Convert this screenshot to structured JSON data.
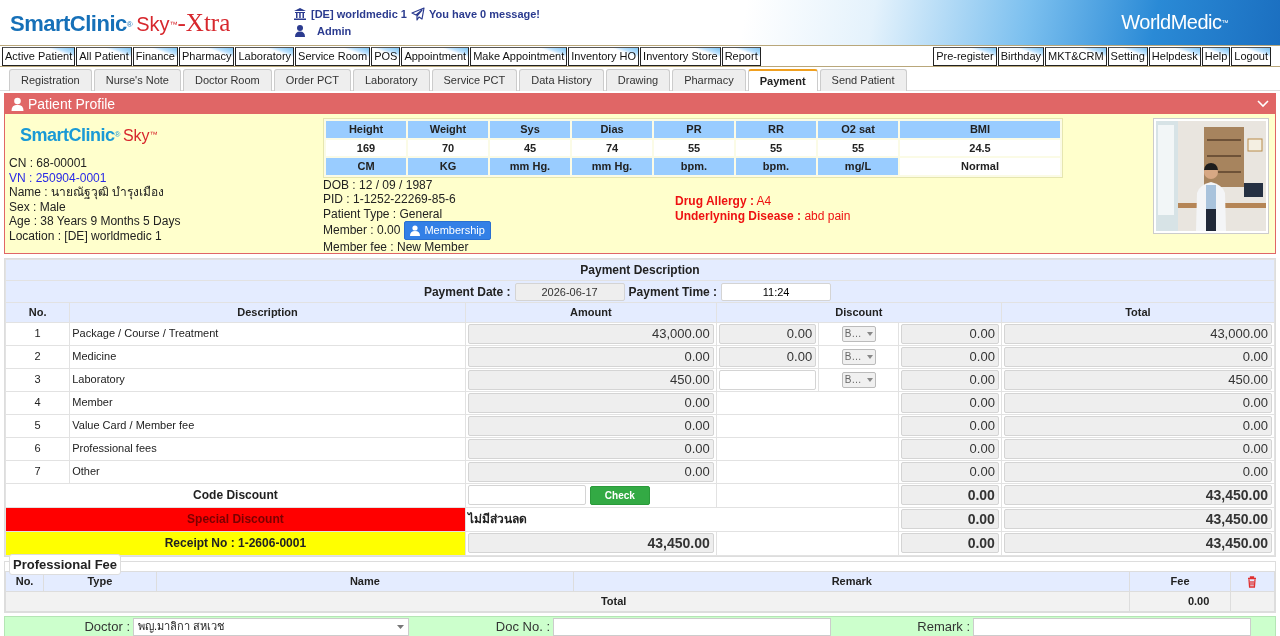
{
  "header": {
    "logo": {
      "name": "SmartClinic$^{®}$",
      "edition": "Sky$^{™}$",
      "suffix": "-Xtra"
    },
    "location": "[DE] worldmedic 1",
    "message": "You have 0 message!",
    "user": "Admin",
    "brand": "WorldMedic$^{™}$"
  },
  "main_menu": {
    "left": [
      "Active Patient",
      "All Patient",
      "Finance",
      "Pharmacy",
      "Laboratory",
      "Service Room",
      "POS",
      "Appointment",
      "Make Appointment",
      "Inventory HO",
      "Inventory Store",
      "Report"
    ],
    "right": [
      "Pre-register",
      "Birthday",
      "MKT&CRM",
      "Setting",
      "Helpdesk",
      "Help",
      "Logout"
    ]
  },
  "tabs": [
    {
      "label": "Registration",
      "selected": false
    },
    {
      "label": "Nurse's Note",
      "selected": false
    },
    {
      "label": "Doctor Room",
      "selected": false
    },
    {
      "label": "Order PCT",
      "selected": false
    },
    {
      "label": "Laboratory",
      "selected": false
    },
    {
      "label": "Service PCT",
      "selected": false
    },
    {
      "label": "Data History",
      "selected": false
    },
    {
      "label": "Drawing",
      "selected": false
    },
    {
      "label": "Pharmacy",
      "selected": false
    },
    {
      "label": "Payment",
      "selected": true
    },
    {
      "label": "Send Patient",
      "selected": false
    }
  ],
  "patient_profile": {
    "title": "Patient Profile",
    "logo": {
      "name": "SmartClinic$^{®}$",
      "edition": "Sky$^{™}$"
    },
    "details": [
      {
        "text": "CN : 68-00001",
        "kind": "text"
      },
      {
        "text": "VN : 250904-0001",
        "kind": "link"
      },
      {
        "text": "Name : นายณัฐวุฒิ บำรุงเมือง",
        "kind": "text"
      },
      {
        "text": "Sex : Male",
        "kind": "text"
      },
      {
        "text": "Age : 38 Years 9 Months 5 Days",
        "kind": "text"
      },
      {
        "text": "Location : [DE] worldmedic 1",
        "kind": "text"
      }
    ],
    "vitals": {
      "headers": [
        "Height",
        "Weight",
        "Sys",
        "Dias",
        "PR",
        "RR",
        "O2 sat",
        "BMI"
      ],
      "values": [
        "169",
        "70",
        "45",
        "74",
        "55",
        "55",
        "55",
        "24.5"
      ],
      "units": [
        {
          "text": "CM",
          "kind": "unit"
        },
        {
          "text": "KG",
          "kind": "unit"
        },
        {
          "text": "mm Hg.",
          "kind": "unit"
        },
        {
          "text": "mm Hg.",
          "kind": "unit"
        },
        {
          "text": "bpm.",
          "kind": "unit"
        },
        {
          "text": "bpm.",
          "kind": "unit"
        },
        {
          "text": "mg/L",
          "kind": "unit"
        },
        {
          "text": "Normal",
          "kind": "status"
        }
      ]
    },
    "info": [
      {
        "text": "DOB : 12 / 09 / 1987"
      },
      {
        "text": "PID : 1-1252-22269-85-6"
      },
      {
        "text": "Patient Type : General"
      },
      {
        "text": "Member : 0.00",
        "button": "Membership"
      },
      {
        "text": "Member fee : New Member"
      }
    ],
    "alerts": [
      "**Drug Allergy :** A4",
      "**Underlyning Disease :** abd pain"
    ],
    "photo": {
      "kind": "picture"
    }
  },
  "payment": {
    "title": "Payment Description",
    "date_label": "Payment Date :",
    "date": "2026-06-17",
    "time_label": "Payment Time :",
    "time": "11:24",
    "columns": [
      "No.",
      "Description",
      "Amount",
      "Discount",
      "Total"
    ],
    "rows": [
      {
        "no": "1",
        "description": "Package / Course / Treatment",
        "amount": "43,000.00",
        "kind": "fixed",
        "discount": "0.00",
        "discount_type": "B…",
        "net_discount": "0.00",
        "total": "43,000.00"
      },
      {
        "no": "2",
        "description": "Medicine",
        "amount": "0.00",
        "kind": "fixed",
        "discount": "0.00",
        "discount_type": "B…",
        "net_discount": "0.00",
        "total": "0.00"
      },
      {
        "no": "3",
        "description": "Laboratory",
        "amount": "450.00",
        "kind": "editable",
        "discount_type": "B…",
        "net_discount": "0.00",
        "total": "450.00"
      },
      {
        "no": "4",
        "description": "Member",
        "amount": "0.00",
        "kind": "none",
        "net_discount": "0.00",
        "total": "0.00"
      },
      {
        "no": "5",
        "description": "Value Card / Member fee",
        "amount": "0.00",
        "kind": "none",
        "net_discount": "0.00",
        "total": "0.00"
      },
      {
        "no": "6",
        "description": "Professional fees",
        "amount": "0.00",
        "kind": "none",
        "net_discount": "0.00",
        "total": "0.00"
      },
      {
        "no": "7",
        "description": "Other",
        "amount": "0.00",
        "kind": "none",
        "net_discount": "0.00",
        "total": "0.00"
      }
    ],
    "summary": [
      {
        "kind": "code",
        "label": "Code Discount",
        "button": "Check",
        "discount": "0.00",
        "total": "43,450.00"
      },
      {
        "kind": "special",
        "label": "Special Discount",
        "note": "ไม่มีส่วนลด",
        "discount": "0.00",
        "total": "43,450.00"
      },
      {
        "kind": "receipt",
        "label": "Receipt No : 1-2606-0001",
        "amount": "43,450.00",
        "discount": "0.00",
        "total": "43,450.00"
      }
    ]
  },
  "professional_fee": {
    "title": "Professional Fee",
    "columns": [
      "No.",
      "Type",
      "Name",
      "Remark",
      "Fee"
    ],
    "total_label": "Total",
    "total": "0.00"
  },
  "doctor_form": {
    "fields": [
      {
        "label": "Doctor :",
        "kind": "select",
        "value": "พญ.มาลิกา สหเวช"
      },
      {
        "label": "Doc No. :",
        "kind": "text"
      },
      {
        "label": "Remark :",
        "kind": "text"
      }
    ]
  }
}
